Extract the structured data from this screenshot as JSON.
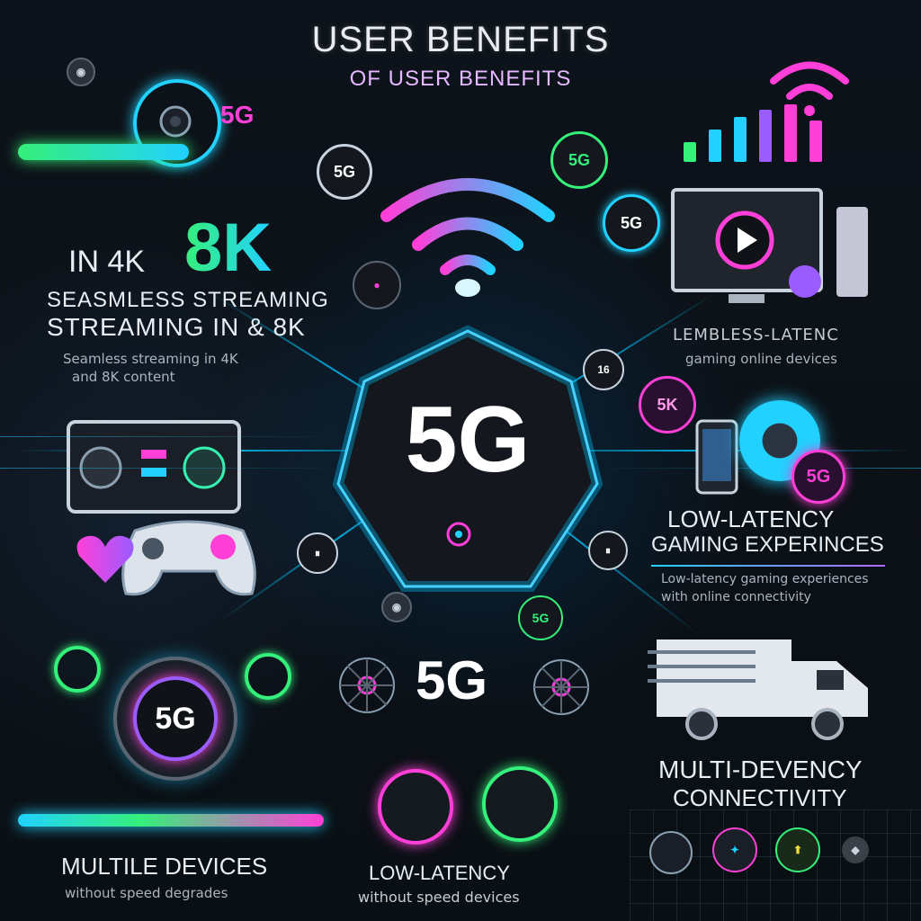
{
  "header": {
    "title": "USER BENEFITS",
    "subtitle": "OF USER BENEFITS"
  },
  "center": {
    "badge": "5G",
    "badge_small": "5G"
  },
  "left_top": {
    "prefix": "IN 4K",
    "highlight": "8K",
    "line1": "SEASMLESS STREAMING",
    "line2": "STREAMING IN & 8K",
    "caption1": "Seamless streaming in 4K",
    "caption2": "and 8K content",
    "badge": "5G"
  },
  "right_top": {
    "caption1": "LEMBLESS-LATENC",
    "caption2": "gaming online devices"
  },
  "right_mid": {
    "line1": "LOW-LATENCY",
    "line2": "GAMING EXPERINCES",
    "caption1": "Low-latency gaming experiences",
    "caption2": "with online connectivity",
    "badge": "5G"
  },
  "right_bottom": {
    "line1": "MULTI-DEVENCY",
    "line2": "CONNECTIVITY"
  },
  "left_bottom": {
    "badge": "5G",
    "title": "MULTILE DEVICES",
    "caption": "without speed degrades"
  },
  "center_bottom": {
    "badge": "5G",
    "title": "LOW-LATENCY",
    "caption": "without speed devices"
  },
  "chips": {
    "c1": "5G",
    "c2": "5G",
    "c3": "5G",
    "c4": "5G",
    "c5": "5K",
    "c6": "5G",
    "c7": "16"
  },
  "colors": {
    "cyan": "#21d1ff",
    "magenta": "#ff3fd8",
    "green": "#35f07a",
    "purple": "#9b5cff"
  }
}
